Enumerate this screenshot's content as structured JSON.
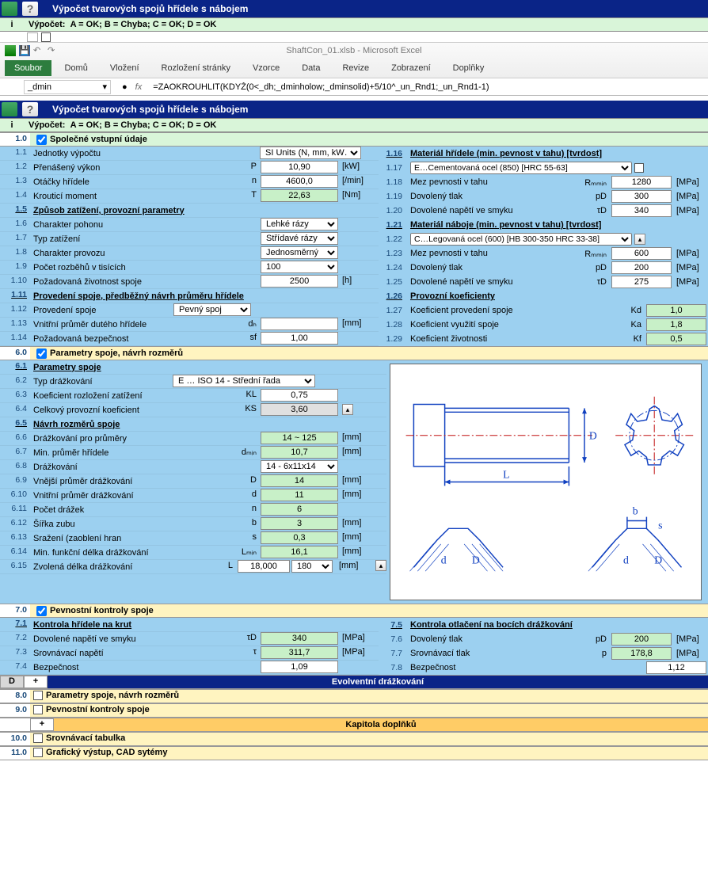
{
  "window_title": "Výpočet tvarových spojů hřídele s nábojem",
  "status_label": "Výpočet:",
  "status_text": "A = OK;   B = Chyba;   C = OK;   D = OK",
  "excel": {
    "filename": "ShaftCon_01.xlsb - Microsoft Excel",
    "name_box": "_dmin",
    "formula": "=ZAOKROUHLIT(KDYŽ(0<_dh;_dminholow;_dminsolid)+5/10^_un_Rnd1;_un_Rnd1-1)",
    "tabs": [
      "Soubor",
      "Domů",
      "Vložení",
      "Rozložení stránky",
      "Vzorce",
      "Data",
      "Revize",
      "Zobrazení",
      "Doplňky"
    ],
    "fx": "fx"
  },
  "i_label": "i",
  "sec1": {
    "num": "1.0",
    "title": "Společné vstupní údaje",
    "r1": {
      "n": "1.1",
      "l": "Jednotky výpočtu",
      "sel": "SI Units (N, mm, kW…)"
    },
    "r2": {
      "n": "1.2",
      "l": "Přenášený výkon",
      "s": "P",
      "v": "10,90",
      "u": "[kW]"
    },
    "r3": {
      "n": "1.3",
      "l": "Otáčky hřídele",
      "s": "n",
      "v": "4600,0",
      "u": "[/min]"
    },
    "r4": {
      "n": "1.4",
      "l": "Krouticí moment",
      "s": "T",
      "v": "22,63",
      "u": "[Nm]"
    },
    "h5": {
      "n": "1.5",
      "l": "Způsob zatížení, provozní parametry"
    },
    "r6": {
      "n": "1.6",
      "l": "Charakter pohonu",
      "sel": "Lehké rázy"
    },
    "r7": {
      "n": "1.7",
      "l": "Typ zatížení",
      "sel": "Střídavé rázy"
    },
    "r8": {
      "n": "1.8",
      "l": "Charakter provozu",
      "sel": "Jednosměrný"
    },
    "r9": {
      "n": "1.9",
      "l": "Počet rozběhů v tisících",
      "sel": "100"
    },
    "r10": {
      "n": "1.10",
      "l": "Požadovaná životnost spoje",
      "v": "2500",
      "u": "[h]"
    },
    "h11": {
      "n": "1.11",
      "l": "Provedení spoje, předběžný návrh průměru hřídele"
    },
    "r12": {
      "n": "1.12",
      "l": "Provedení spoje",
      "sel": "Pevný spoj"
    },
    "r13": {
      "n": "1.13",
      "l": "Vnitřní průměr dutého hřídele",
      "s": "dₕ",
      "v": "",
      "u": "[mm]"
    },
    "r14": {
      "n": "1.14",
      "l": "Požadovaná bezpečnost",
      "s": "sf",
      "v": "1,00"
    },
    "rr16": {
      "n": "1.16",
      "l": "Materiál hřídele  (min. pevnost v tahu)  [tvrdost]"
    },
    "rr17": {
      "n": "1.17",
      "sel": "E…Cementovaná ocel  (850)   [HRC 55-63]"
    },
    "rr18": {
      "n": "1.18",
      "l": "Mez pevnosti v tahu",
      "s": "Rₘₘᵢₙ",
      "v": "1280",
      "u": "[MPa]"
    },
    "rr19": {
      "n": "1.19",
      "l": "Dovolený tlak",
      "s": "pD",
      "v": "300",
      "u": "[MPa]"
    },
    "rr20": {
      "n": "1.20",
      "l": "Dovolené napětí ve smyku",
      "s": "τD",
      "v": "340",
      "u": "[MPa]"
    },
    "rr21": {
      "n": "1.21",
      "l": "Materiál náboje  (min. pevnost v tahu)  [tvrdost]"
    },
    "rr22": {
      "n": "1.22",
      "sel": "C…Legovaná ocel  (600)   [HB 300-350  HRC 33-38]"
    },
    "rr23": {
      "n": "1.23",
      "l": "Mez pevnosti v tahu",
      "s": "Rₘₘᵢₙ",
      "v": "600",
      "u": "[MPa]"
    },
    "rr24": {
      "n": "1.24",
      "l": "Dovolený tlak",
      "s": "pD",
      "v": "200",
      "u": "[MPa]"
    },
    "rr25": {
      "n": "1.25",
      "l": "Dovolené napětí ve smyku",
      "s": "τD",
      "v": "275",
      "u": "[MPa]"
    },
    "rr26": {
      "n": "1.26",
      "l": "Provozní koeficienty"
    },
    "rr27": {
      "n": "1.27",
      "l": "Koeficient provedení spoje",
      "s": "Kd",
      "v": "1,0"
    },
    "rr28": {
      "n": "1.28",
      "l": "Koeficient využití spoje",
      "s": "Ka",
      "v": "1,8"
    },
    "rr29": {
      "n": "1.29",
      "l": "Koeficient životnosti",
      "s": "Kf",
      "v": "0,5"
    }
  },
  "sec6": {
    "num": "6.0",
    "title": "Parametry spoje, návrh rozměrů",
    "h1": {
      "n": "6.1",
      "l": "Parametry spoje"
    },
    "r2": {
      "n": "6.2",
      "l": "Typ drážkování",
      "sel": "E … ISO 14  - Střední řada"
    },
    "r3": {
      "n": "6.3",
      "l": "Koeficient rozložení zatížení",
      "s": "KL",
      "v": "0,75"
    },
    "r4": {
      "n": "6.4",
      "l": "Celkový provozní koeficient",
      "s": "KS",
      "v": "3,60"
    },
    "h5": {
      "n": "6.5",
      "l": "Návrh rozměrů spoje"
    },
    "r6": {
      "n": "6.6",
      "l": "Drážkování pro průměry",
      "v": "14 ~ 125",
      "u": "[mm]"
    },
    "r7": {
      "n": "6.7",
      "l": "Min. průměr hřídele",
      "s": "dₘᵢₙ",
      "v": "10,7",
      "u": "[mm]"
    },
    "r8": {
      "n": "6.8",
      "l": "Drážkování",
      "sel": "14 - 6x11x14"
    },
    "r9": {
      "n": "6.9",
      "l": "Vnější průměr drážkování",
      "s": "D",
      "v": "14",
      "u": "[mm]"
    },
    "r10": {
      "n": "6.10",
      "l": "Vnitřní průměr drážkování",
      "s": "d",
      "v": "11",
      "u": "[mm]"
    },
    "r11": {
      "n": "6.11",
      "l": "Počet drážek",
      "s": "n",
      "v": "6"
    },
    "r12": {
      "n": "6.12",
      "l": "Šířka zubu",
      "s": "b",
      "v": "3",
      "u": "[mm]"
    },
    "r13": {
      "n": "6.13",
      "l": "Sražení (zaoblení hran",
      "s": "s",
      "v": "0,3",
      "u": "[mm]"
    },
    "r14": {
      "n": "6.14",
      "l": "Min. funkční délka drážkování",
      "s": "Lₘᵢₙ",
      "v": "16,1",
      "u": "[mm]"
    },
    "r15": {
      "n": "6.15",
      "l": "Zvolená délka drážkování",
      "s": "L",
      "v": "18,000",
      "sel": "180",
      "u": "[mm]"
    }
  },
  "sec7": {
    "num": "7.0",
    "title": "Pevnostní kontroly spoje",
    "h1": {
      "n": "7.1",
      "l": "Kontrola hřídele na krut"
    },
    "r2": {
      "n": "7.2",
      "l": "Dovolené napětí ve smyku",
      "s": "τD",
      "v": "340",
      "u": "[MPa]"
    },
    "r3": {
      "n": "7.3",
      "l": "Srovnávací napětí",
      "s": "τ",
      "v": "311,7",
      "u": "[MPa]"
    },
    "r4": {
      "n": "7.4",
      "l": "Bezpečnost",
      "v": "1,09"
    },
    "h5": {
      "n": "7.5",
      "l": "Kontrola otlačení na bocích drážkování"
    },
    "r6": {
      "n": "7.6",
      "l": "Dovolený tlak",
      "s": "pD",
      "v": "200",
      "u": "[MPa]"
    },
    "r7": {
      "n": "7.7",
      "l": "Srovnávací tlak",
      "s": "p",
      "v": "178,8",
      "u": "[MPa]"
    },
    "r8": {
      "n": "7.8",
      "l": "Bezpečnost",
      "v": "1,12"
    }
  },
  "footer": {
    "d_label": "D",
    "plus": "+",
    "evol": "Evolventní drážkování",
    "s8": {
      "n": "8.0",
      "t": "Parametry spoje, návrh rozměrů"
    },
    "s9": {
      "n": "9.0",
      "t": "Pevnostní kontroly spoje"
    },
    "kap": "Kapitola doplňků",
    "s10": {
      "n": "10.0",
      "t": "Srovnávací tabulka"
    },
    "s11": {
      "n": "11.0",
      "t": "Grafický výstup, CAD sytémy"
    }
  },
  "diagram": {
    "L": "L",
    "D": "D",
    "b": "b",
    "s": "s",
    "d": "d"
  }
}
